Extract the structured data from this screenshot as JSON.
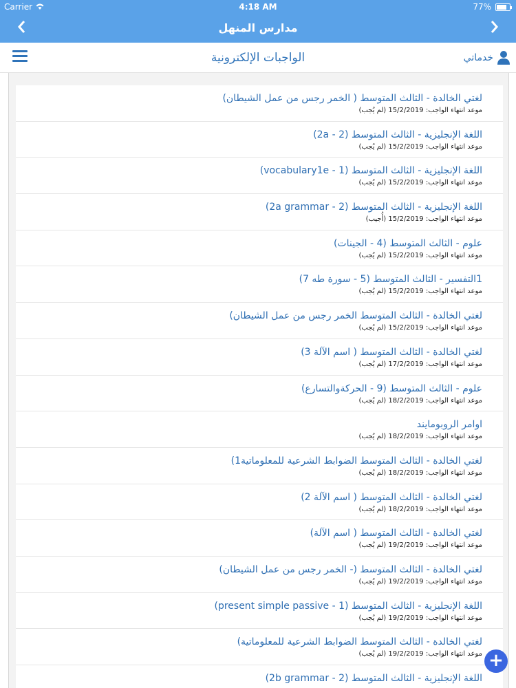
{
  "status_bar": {
    "carrier": "Carrier",
    "wifi_icon": "wifi-icon",
    "time": "4:18 AM",
    "battery_percent": "77%",
    "battery_icon": "battery-icon"
  },
  "nav": {
    "title": "مدارس المنهل",
    "back_icon": "chevron-left-icon",
    "forward_icon": "chevron-right-icon"
  },
  "header": {
    "title": "الواجبات الإلكترونية",
    "services_label": "خدماتي",
    "user_icon": "user-icon",
    "menu_icon": "hamburger-menu-icon"
  },
  "assignments": [
    {
      "title": "لغتي الخالدة - الثالث المتوسط ( الخمر رجس من عمل الشيطان)",
      "subtitle": "موعد انتهاء الواجب: 15/2/2019 (لم يُجب)"
    },
    {
      "title": "اللغة الإنجليزية - الثالث المتوسط (2 - 2a)",
      "subtitle": "موعد انتهاء الواجب: 15/2/2019 (لم يُجب)"
    },
    {
      "title": "اللغة الإنجليزية - الثالث المتوسط (1 - vocabulary1e)",
      "subtitle": "موعد انتهاء الواجب: 15/2/2019 (لم يُجب)"
    },
    {
      "title": "اللغة الإنجليزية - الثالث المتوسط (2 - 2a grammar)",
      "subtitle": "موعد انتهاء الواجب: 15/2/2019 (أُجيب)"
    },
    {
      "title": "علوم - الثالث المتوسط (4 - الجينات)",
      "subtitle": "موعد انتهاء الواجب: 15/2/2019 (لم يُجب)"
    },
    {
      "title": "1التفسير - الثالث المتوسط (5 - سورة طه 7)",
      "subtitle": "موعد انتهاء الواجب: 15/2/2019 (لم يُجب)"
    },
    {
      "title": "لغتي الخالدة - الثالث المتوسط الخمر رجس من عمل الشيطان)",
      "subtitle": "موعد انتهاء الواجب: 15/2/2019 (لم يُجب)"
    },
    {
      "title": "لغتي الخالدة - الثالث المتوسط ( اسم الآلة 3)",
      "subtitle": "موعد انتهاء الواجب: 17/2/2019 (لم يُجب)"
    },
    {
      "title": "علوم - الثالث المتوسط (9 - الحركةوالتسارع)",
      "subtitle": "موعد انتهاء الواجب: 18/2/2019 (لم يُجب)"
    },
    {
      "title": "اوامر الروبومايند",
      "subtitle": "موعد انتهاء الواجب: 18/2/2019 (لم يُجب)"
    },
    {
      "title": "لغتي الخالدة - الثالث المتوسط الضوابط الشرعية للمعلوماتية1)",
      "subtitle": "موعد انتهاء الواجب: 18/2/2019 (لم يُجب)"
    },
    {
      "title": "لغتي الخالدة - الثالث المتوسط ( اسم الآلة 2)",
      "subtitle": "موعد انتهاء الواجب: 18/2/2019 (لم يُجب)"
    },
    {
      "title": "لغتي الخالدة - الثالث المتوسط ( اسم الآلة)",
      "subtitle": "موعد انتهاء الواجب: 19/2/2019 (لم يُجب)"
    },
    {
      "title": "لغتي الخالدة - الثالث المتوسط (- الخمر رجس من عمل الشيطان)",
      "subtitle": "موعد انتهاء الواجب: 19/2/2019 (لم يُجب)"
    },
    {
      "title": "اللغة الإنجليزية - الثالث المتوسط (1 - present simple passive)",
      "subtitle": "موعد انتهاء الواجب: 19/2/2019 (لم يُجب)"
    },
    {
      "title": "لغتي الخالدة - الثالث المتوسط الضوابط الشرعية للمعلوماتية)",
      "subtitle": "موعد انتهاء الواجب: 19/2/2019 (لم يُجب)"
    },
    {
      "title": "اللغة الإنجليزية - الثالث المتوسط (2 - 2b grammar)",
      "subtitle": ""
    }
  ],
  "fab": {
    "label": "+",
    "icon": "plus-icon"
  },
  "colors": {
    "primary": "#5aa2e8",
    "accent": "#2f73b9",
    "fab": "#3b66e0"
  }
}
